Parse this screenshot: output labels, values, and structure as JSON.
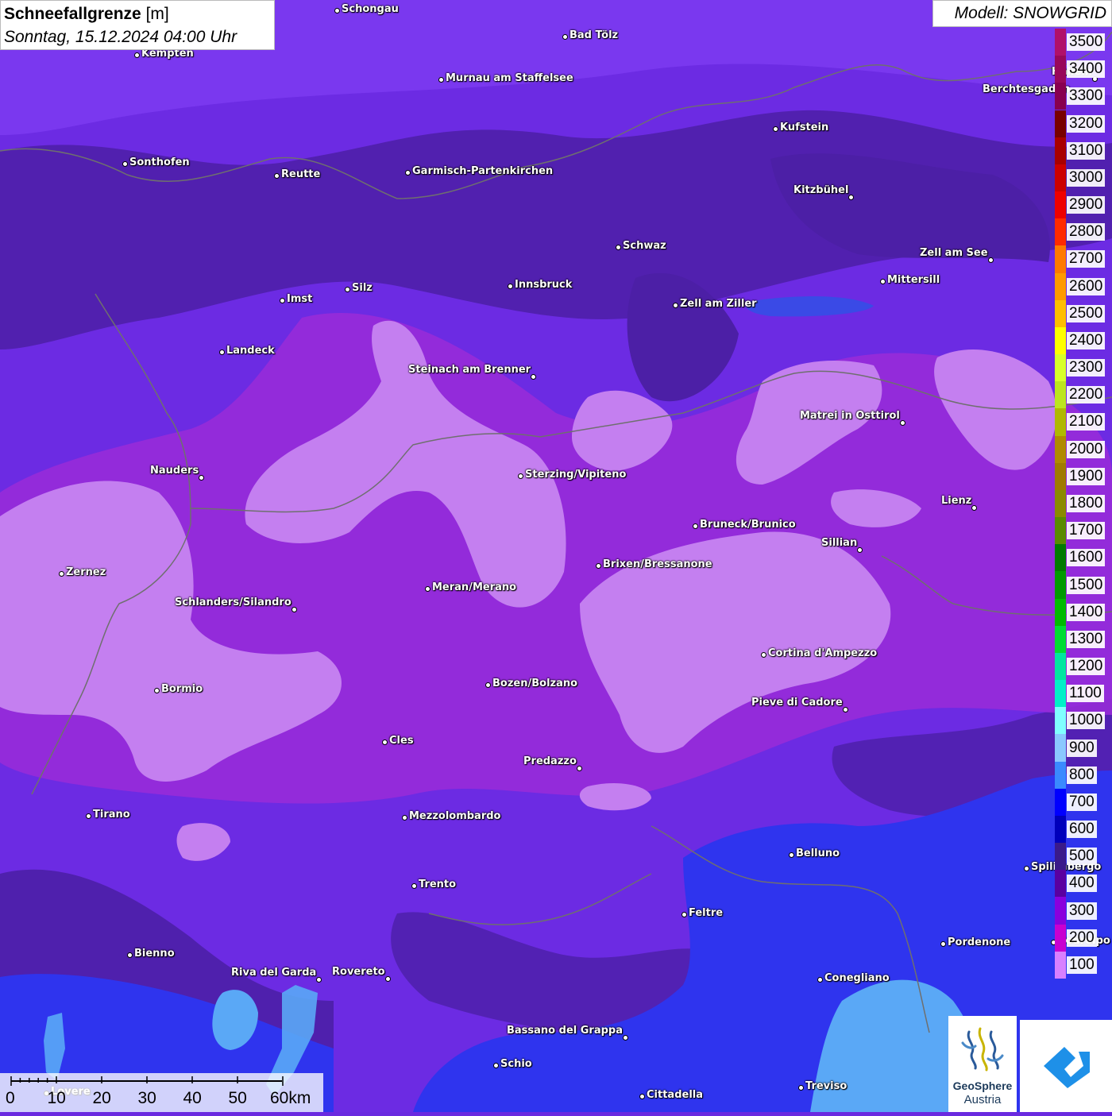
{
  "title": {
    "param": "Schneefallgrenze",
    "unit": "[m]",
    "time": "Sonntag, 15.12.2024 04:00 Uhr"
  },
  "model": "Modell: SNOWGRID",
  "legend": {
    "labels": [
      "3500",
      "3400",
      "3300",
      "3200",
      "3100",
      "3000",
      "2900",
      "2800",
      "2700",
      "2600",
      "2500",
      "2400",
      "2300",
      "2200",
      "2100",
      "2000",
      "1900",
      "1800",
      "1700",
      "1600",
      "1500",
      "1400",
      "1300",
      "1200",
      "1100",
      "1000",
      "900",
      "800",
      "700",
      "600",
      "500",
      "400",
      "300",
      "200",
      "100"
    ],
    "colors": [
      "#c21a78",
      "#b0106a",
      "#98085a",
      "#880050",
      "#780000",
      "#a80000",
      "#cc0000",
      "#ee0000",
      "#ff2a00",
      "#ff7a00",
      "#ff9a00",
      "#ffbe00",
      "#ffff00",
      "#d8ff2a",
      "#bce61e",
      "#b0b800",
      "#b08a00",
      "#a07a00",
      "#8a8a00",
      "#5a8a00",
      "#007a00",
      "#009a00",
      "#00bb00",
      "#00dd33",
      "#00e6a0",
      "#00f0c8",
      "#80ffff",
      "#8ac8ff",
      "#3a8aff",
      "#0000ff",
      "#0000bb",
      "#3a1a8a",
      "#5a00a0",
      "#8a00dd",
      "#c800d0",
      "#d880ff"
    ]
  },
  "scale": {
    "ticks": [
      "0",
      "10",
      "20",
      "30",
      "40",
      "50",
      "60km"
    ]
  },
  "cities": [
    {
      "name": "Schongau"
    },
    {
      "name": "Bad Tölz"
    },
    {
      "name": "Kempten"
    },
    {
      "name": "Murnau am Staffelsee"
    },
    {
      "name": "Hallein"
    },
    {
      "name": "Berchtesgaden"
    },
    {
      "name": "Kufstein"
    },
    {
      "name": "Sonthofen"
    },
    {
      "name": "Reutte"
    },
    {
      "name": "Garmisch-Partenkirchen"
    },
    {
      "name": "Kitzbühel"
    },
    {
      "name": "Schwaz"
    },
    {
      "name": "Zell am See"
    },
    {
      "name": "Innsbruck"
    },
    {
      "name": "Mittersill"
    },
    {
      "name": "Silz"
    },
    {
      "name": "Imst"
    },
    {
      "name": "Zell am Ziller"
    },
    {
      "name": "Landeck"
    },
    {
      "name": "Steinach am Brenner"
    },
    {
      "name": "Matrei in Osttirol"
    },
    {
      "name": "Nauders"
    },
    {
      "name": "Sterzing/Vipiteno"
    },
    {
      "name": "Lienz"
    },
    {
      "name": "Bruneck/Brunico"
    },
    {
      "name": "Sillian"
    },
    {
      "name": "Zernez"
    },
    {
      "name": "Brixen/Bressanone"
    },
    {
      "name": "Meran/Merano"
    },
    {
      "name": "Schlanders/Silandro"
    },
    {
      "name": "Cortina d'Ampezzo"
    },
    {
      "name": "Bozen/Bolzano"
    },
    {
      "name": "Bormio"
    },
    {
      "name": "Pieve di Cadore"
    },
    {
      "name": "Cles"
    },
    {
      "name": "Predazzo"
    },
    {
      "name": "Tirano"
    },
    {
      "name": "Mezzolombardo"
    },
    {
      "name": "Belluno"
    },
    {
      "name": "Spilimbergo"
    },
    {
      "name": "Trento"
    },
    {
      "name": "Feltre"
    },
    {
      "name": "Pordenone"
    },
    {
      "name": "Bienno"
    },
    {
      "name": "Riva del Garda"
    },
    {
      "name": "Rovereto"
    },
    {
      "name": "Conegliano"
    },
    {
      "name": "Bassano del Grappa"
    },
    {
      "name": "Schio"
    },
    {
      "name": "Treviso"
    },
    {
      "name": "Cittadella"
    },
    {
      "name": "Lovere"
    },
    {
      "name": "Codroipo"
    }
  ],
  "logo": {
    "line1": "GeoSphere",
    "line2": "Austria"
  }
}
